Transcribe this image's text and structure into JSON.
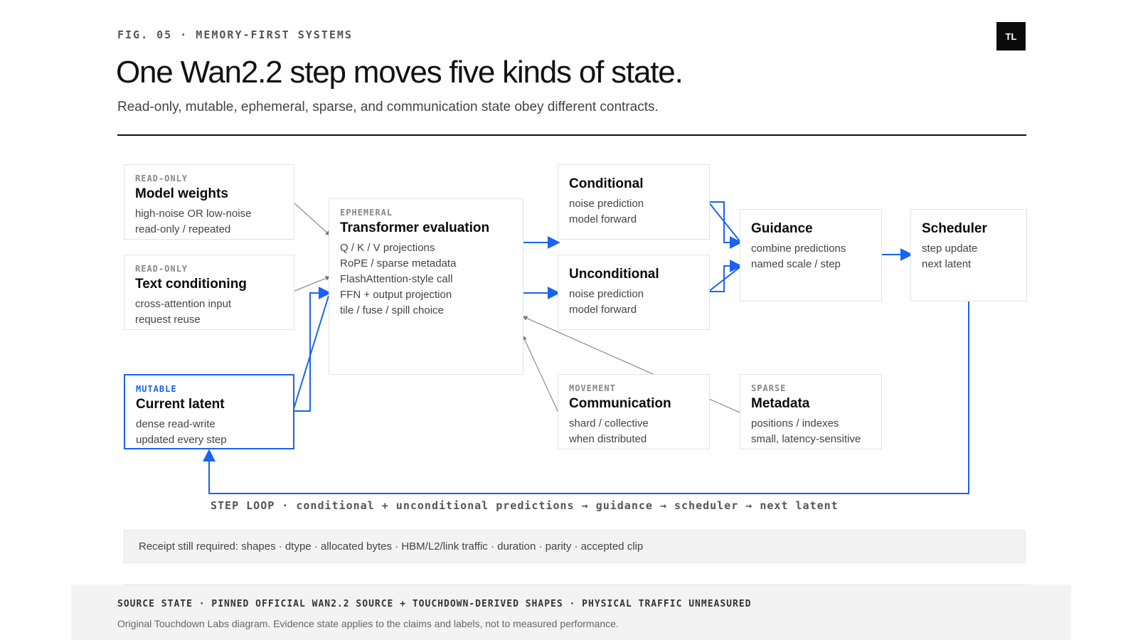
{
  "header": {
    "eyebrow": "FIG. 05 · MEMORY-FIRST SYSTEMS",
    "logo": "TL",
    "title": "One Wan2.2 step moves five kinds of state.",
    "subtitle": "Read-only, mutable, ephemeral, sparse, and communication state obey different contracts."
  },
  "nodes": {
    "model_weights": {
      "tag": "READ-ONLY",
      "title": "Model weights",
      "lines": [
        "high-noise OR low-noise",
        "read-only / repeated"
      ]
    },
    "text_conditioning": {
      "tag": "READ-ONLY",
      "title": "Text conditioning",
      "lines": [
        "cross-attention input",
        "request reuse"
      ]
    },
    "current_latent": {
      "tag": "MUTABLE",
      "title": "Current latent",
      "lines": [
        "dense read-write",
        "updated every step"
      ]
    },
    "transformer": {
      "tag": "EPHEMERAL",
      "title": "Transformer evaluation",
      "lines": [
        "Q / K / V projections",
        "RoPE / sparse metadata",
        "FlashAttention-style call",
        "FFN + output projection",
        "tile / fuse / spill choice"
      ]
    },
    "conditional": {
      "title": "Conditional",
      "lines": [
        "noise prediction",
        "model forward"
      ]
    },
    "unconditional": {
      "title": "Unconditional",
      "lines": [
        "noise prediction",
        "model forward"
      ]
    },
    "communication": {
      "tag": "MOVEMENT",
      "title": "Communication",
      "lines": [
        "shard / collective",
        "when distributed"
      ]
    },
    "guidance": {
      "title": "Guidance",
      "lines": [
        "combine predictions",
        "named scale / step"
      ]
    },
    "metadata": {
      "tag": "SPARSE",
      "title": "Metadata",
      "lines": [
        "positions / indexes",
        "small, latency-sensitive"
      ]
    },
    "scheduler": {
      "title": "Scheduler",
      "lines": [
        "step update",
        "next latent"
      ]
    }
  },
  "loop_caption": "STEP LOOP · conditional + unconditional predictions → guidance → scheduler → next latent",
  "receipt": "Receipt still required: shapes · dtype · allocated bytes · HBM/L2/link traffic · duration · parity · accepted clip",
  "footer": {
    "source": "SOURCE STATE · PINNED OFFICIAL WAN2.2 SOURCE + TOUCHDOWN-DERIVED SHAPES · PHYSICAL TRAFFIC UNMEASURED",
    "note": "Original Touchdown Labs diagram. Evidence state applies to the claims and labels, not to measured performance."
  },
  "colors": {
    "accent": "#1a63f0",
    "ink": "#0a0a0a",
    "muted": "#444444",
    "border": "#e2e2e2",
    "connector_gray": "#777777"
  },
  "icons": {
    "arrowhead_blue": "arrow-head-icon",
    "arrowhead_gray": "arrow-head-icon"
  }
}
